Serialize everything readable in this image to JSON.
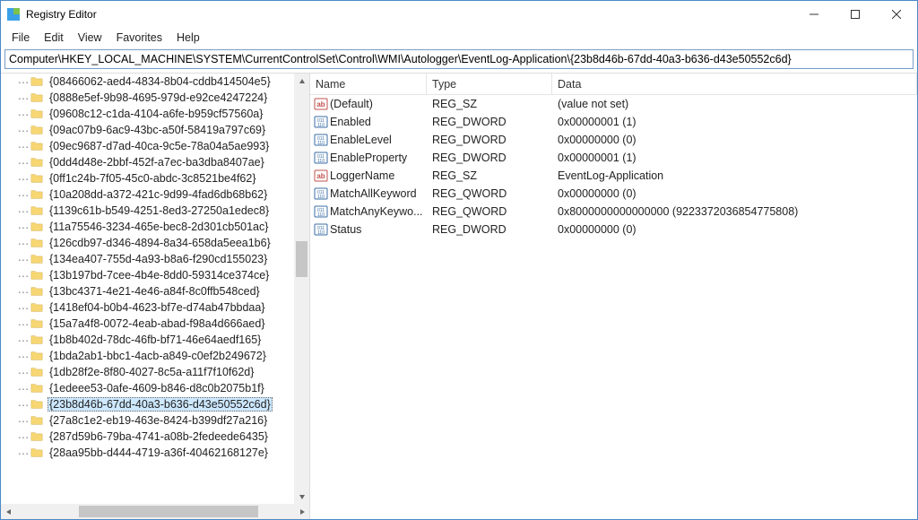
{
  "window": {
    "title": "Registry Editor"
  },
  "menu": {
    "file": "File",
    "edit": "Edit",
    "view": "View",
    "favorites": "Favorites",
    "help": "Help"
  },
  "address": {
    "value": "Computer\\HKEY_LOCAL_MACHINE\\SYSTEM\\CurrentControlSet\\Control\\WMI\\Autologger\\EventLog-Application\\{23b8d46b-67dd-40a3-b636-d43e50552c6d}"
  },
  "tree": {
    "items": [
      {
        "label": "{08466062-aed4-4834-8b04-cddb414504e5}",
        "selected": false
      },
      {
        "label": "{0888e5ef-9b98-4695-979d-e92ce4247224}",
        "selected": false
      },
      {
        "label": "{09608c12-c1da-4104-a6fe-b959cf57560a}",
        "selected": false
      },
      {
        "label": "{09ac07b9-6ac9-43bc-a50f-58419a797c69}",
        "selected": false
      },
      {
        "label": "{09ec9687-d7ad-40ca-9c5e-78a04a5ae993}",
        "selected": false
      },
      {
        "label": "{0dd4d48e-2bbf-452f-a7ec-ba3dba8407ae}",
        "selected": false
      },
      {
        "label": "{0ff1c24b-7f05-45c0-abdc-3c8521be4f62}",
        "selected": false
      },
      {
        "label": "{10a208dd-a372-421c-9d99-4fad6db68b62}",
        "selected": false
      },
      {
        "label": "{1139c61b-b549-4251-8ed3-27250a1edec8}",
        "selected": false
      },
      {
        "label": "{11a75546-3234-465e-bec8-2d301cb501ac}",
        "selected": false
      },
      {
        "label": "{126cdb97-d346-4894-8a34-658da5eea1b6}",
        "selected": false
      },
      {
        "label": "{134ea407-755d-4a93-b8a6-f290cd155023}",
        "selected": false
      },
      {
        "label": "{13b197bd-7cee-4b4e-8dd0-59314ce374ce}",
        "selected": false
      },
      {
        "label": "{13bc4371-4e21-4e46-a84f-8c0ffb548ced}",
        "selected": false
      },
      {
        "label": "{1418ef04-b0b4-4623-bf7e-d74ab47bbdaa}",
        "selected": false
      },
      {
        "label": "{15a7a4f8-0072-4eab-abad-f98a4d666aed}",
        "selected": false
      },
      {
        "label": "{1b8b402d-78dc-46fb-bf71-46e64aedf165}",
        "selected": false
      },
      {
        "label": "{1bda2ab1-bbc1-4acb-a849-c0ef2b249672}",
        "selected": false
      },
      {
        "label": "{1db28f2e-8f80-4027-8c5a-a11f7f10f62d}",
        "selected": false
      },
      {
        "label": "{1edeee53-0afe-4609-b846-d8c0b2075b1f}",
        "selected": false
      },
      {
        "label": "{23b8d46b-67dd-40a3-b636-d43e50552c6d}",
        "selected": true
      },
      {
        "label": "{27a8c1e2-eb19-463e-8424-b399df27a216}",
        "selected": false
      },
      {
        "label": "{287d59b6-79ba-4741-a08b-2fedeede6435}",
        "selected": false
      },
      {
        "label": "{28aa95bb-d444-4719-a36f-40462168127e}",
        "selected": false
      }
    ]
  },
  "columns": {
    "name": "Name",
    "type": "Type",
    "data": "Data"
  },
  "values": [
    {
      "icon": "sz",
      "name": "(Default)",
      "type": "REG_SZ",
      "data": "(value not set)"
    },
    {
      "icon": "dword",
      "name": "Enabled",
      "type": "REG_DWORD",
      "data": "0x00000001 (1)"
    },
    {
      "icon": "dword",
      "name": "EnableLevel",
      "type": "REG_DWORD",
      "data": "0x00000000 (0)"
    },
    {
      "icon": "dword",
      "name": "EnableProperty",
      "type": "REG_DWORD",
      "data": "0x00000001 (1)"
    },
    {
      "icon": "sz",
      "name": "LoggerName",
      "type": "REG_SZ",
      "data": "EventLog-Application"
    },
    {
      "icon": "dword",
      "name": "MatchAllKeyword",
      "type": "REG_QWORD",
      "data": "0x00000000 (0)"
    },
    {
      "icon": "dword",
      "name": "MatchAnyKeywo...",
      "type": "REG_QWORD",
      "data": "0x8000000000000000 (9223372036854775808)"
    },
    {
      "icon": "dword",
      "name": "Status",
      "type": "REG_DWORD",
      "data": "0x00000000 (0)"
    }
  ]
}
